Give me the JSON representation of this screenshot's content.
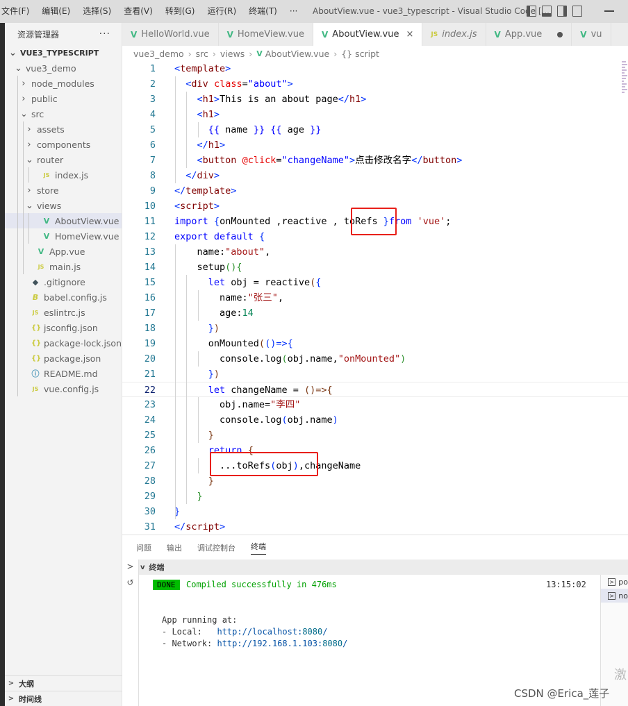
{
  "titlebar": {
    "menu": [
      "文件(F)",
      "编辑(E)",
      "选择(S)",
      "查看(V)",
      "转到(G)",
      "运行(R)",
      "终端(T)",
      "···"
    ],
    "title": "AboutView.vue - vue3_typescript - Visual Studio Code [..."
  },
  "sidebar": {
    "header": "资源管理器",
    "more": "···",
    "tree": [
      {
        "label": "VUE3_TYPESCRIPT",
        "depth": 0,
        "chev": "v",
        "icon": "",
        "root": true
      },
      {
        "label": "vue3_demo",
        "depth": 1,
        "chev": "v",
        "icon": ""
      },
      {
        "label": "node_modules",
        "depth": 2,
        "chev": ">",
        "icon": ""
      },
      {
        "label": "public",
        "depth": 2,
        "chev": ">",
        "icon": ""
      },
      {
        "label": "src",
        "depth": 2,
        "chev": "v",
        "icon": ""
      },
      {
        "label": "assets",
        "depth": 3,
        "chev": ">",
        "icon": ""
      },
      {
        "label": "components",
        "depth": 3,
        "chev": ">",
        "icon": ""
      },
      {
        "label": "router",
        "depth": 3,
        "chev": "v",
        "icon": ""
      },
      {
        "label": "index.js",
        "depth": 4,
        "chev": "",
        "icon": "js"
      },
      {
        "label": "store",
        "depth": 3,
        "chev": ">",
        "icon": ""
      },
      {
        "label": "views",
        "depth": 3,
        "chev": "v",
        "icon": ""
      },
      {
        "label": "AboutView.vue",
        "depth": 4,
        "chev": "",
        "icon": "vue",
        "active": true
      },
      {
        "label": "HomeView.vue",
        "depth": 4,
        "chev": "",
        "icon": "vue"
      },
      {
        "label": "App.vue",
        "depth": 3,
        "chev": "",
        "icon": "vue"
      },
      {
        "label": "main.js",
        "depth": 3,
        "chev": "",
        "icon": "js"
      },
      {
        "label": ".gitignore",
        "depth": 2,
        "chev": "",
        "icon": "git"
      },
      {
        "label": "babel.config.js",
        "depth": 2,
        "chev": "",
        "icon": "babel"
      },
      {
        "label": "eslintrc.js",
        "depth": 2,
        "chev": "",
        "icon": "js"
      },
      {
        "label": "jsconfig.json",
        "depth": 2,
        "chev": "",
        "icon": "json"
      },
      {
        "label": "package-lock.json",
        "depth": 2,
        "chev": "",
        "icon": "json"
      },
      {
        "label": "package.json",
        "depth": 2,
        "chev": "",
        "icon": "json"
      },
      {
        "label": "README.md",
        "depth": 2,
        "chev": "",
        "icon": "info"
      },
      {
        "label": "vue.config.js",
        "depth": 2,
        "chev": "",
        "icon": "js"
      }
    ],
    "outline": "大纲",
    "timeline": "时间线"
  },
  "tabs": [
    {
      "label": "HelloWorld.vue",
      "icon": "vue"
    },
    {
      "label": "HomeView.vue",
      "icon": "vue"
    },
    {
      "label": "AboutView.vue",
      "icon": "vue",
      "active": true,
      "close": "×"
    },
    {
      "label": "index.js",
      "icon": "js"
    },
    {
      "label": "App.vue",
      "icon": "vue",
      "dirty": true
    },
    {
      "label": "vu",
      "icon": "vue"
    }
  ],
  "breadcrumb": [
    "vue3_demo",
    "src",
    "views",
    "AboutView.vue",
    "{} script"
  ],
  "editor": {
    "current_line": 22,
    "lines": [
      [
        [
          "t-br",
          "<"
        ],
        [
          "t-tag",
          "template"
        ],
        [
          "t-br",
          ">"
        ]
      ],
      [
        [
          "",
          "  "
        ],
        [
          "t-br",
          "<"
        ],
        [
          "t-tag",
          "div"
        ],
        [
          "",
          " "
        ],
        [
          "t-attr",
          "class"
        ],
        [
          "",
          "="
        ],
        [
          "t-kw",
          "\"about\""
        ],
        [
          "t-br",
          ">"
        ]
      ],
      [
        [
          "",
          "    "
        ],
        [
          "t-br",
          "<"
        ],
        [
          "t-tag",
          "h1"
        ],
        [
          "t-br",
          ">"
        ],
        [
          "",
          "This is an about page"
        ],
        [
          "t-br",
          "</"
        ],
        [
          "t-tag",
          "h1"
        ],
        [
          "t-br",
          ">"
        ]
      ],
      [
        [
          "",
          "    "
        ],
        [
          "t-br",
          "<"
        ],
        [
          "t-tag",
          "h1"
        ],
        [
          "t-br",
          ">"
        ]
      ],
      [
        [
          "",
          "      "
        ],
        [
          "t-kw",
          "{{"
        ],
        [
          "",
          " name "
        ],
        [
          "t-kw",
          "}}"
        ],
        [
          "",
          " "
        ],
        [
          "t-kw",
          "{{"
        ],
        [
          "",
          " age "
        ],
        [
          "t-kw",
          "}}"
        ]
      ],
      [
        [
          "",
          "    "
        ],
        [
          "t-br",
          "</"
        ],
        [
          "t-tag",
          "h1"
        ],
        [
          "t-br",
          ">"
        ]
      ],
      [
        [
          "",
          "    "
        ],
        [
          "t-br",
          "<"
        ],
        [
          "t-tag",
          "button"
        ],
        [
          "",
          " "
        ],
        [
          "t-attr",
          "@click"
        ],
        [
          "",
          "="
        ],
        [
          "t-kw",
          "\"changeName\""
        ],
        [
          "t-br",
          ">"
        ],
        [
          "",
          "点击修改名字"
        ],
        [
          "t-br",
          "</"
        ],
        [
          "t-tag",
          "button"
        ],
        [
          "t-br",
          ">"
        ]
      ],
      [
        [
          "",
          "  "
        ],
        [
          "t-br",
          "</"
        ],
        [
          "t-tag",
          "div"
        ],
        [
          "t-br",
          ">"
        ]
      ],
      [
        [
          "t-br",
          "</"
        ],
        [
          "t-tag",
          "template"
        ],
        [
          "t-br",
          ">"
        ]
      ],
      [
        [
          "t-br",
          "<"
        ],
        [
          "t-tag",
          "script"
        ],
        [
          "t-br",
          ">"
        ]
      ],
      [
        [
          "t-kw",
          "import"
        ],
        [
          "",
          " "
        ],
        [
          "t-br",
          "{"
        ],
        [
          "",
          "onMounted ,reactive , toRefs "
        ],
        [
          "t-br",
          "}"
        ],
        [
          "t-kw",
          "from"
        ],
        [
          "",
          " "
        ],
        [
          "t-str",
          "'vue'"
        ],
        [
          "",
          ";"
        ]
      ],
      [
        [
          "t-kw",
          "export default"
        ],
        [
          "",
          " "
        ],
        [
          "t-br",
          "{"
        ]
      ],
      [
        [
          "",
          "    name:"
        ],
        [
          "t-str",
          "\"about\""
        ],
        [
          "",
          ","
        ]
      ],
      [
        [
          "",
          "    setup"
        ],
        [
          "t-br2",
          "()"
        ],
        [
          "t-br2",
          "{"
        ]
      ],
      [
        [
          "",
          "      "
        ],
        [
          "t-kw",
          "let"
        ],
        [
          "",
          " obj = reactive"
        ],
        [
          "t-br3",
          "("
        ],
        [
          "t-br",
          "{"
        ]
      ],
      [
        [
          "",
          "        name:"
        ],
        [
          "t-str",
          "\"张三\""
        ],
        [
          "",
          ","
        ]
      ],
      [
        [
          "",
          "        age:"
        ],
        [
          "t-num",
          "14"
        ]
      ],
      [
        [
          "",
          "      "
        ],
        [
          "t-br",
          "}"
        ],
        [
          "t-br3",
          ")"
        ]
      ],
      [
        [
          "",
          "      onMounted"
        ],
        [
          "t-br3",
          "("
        ],
        [
          "t-br",
          "()=>{"
        ]
      ],
      [
        [
          "",
          "        console.log"
        ],
        [
          "t-br2",
          "("
        ],
        [
          "",
          "obj.name,"
        ],
        [
          "t-str",
          "\"onMounted\""
        ],
        [
          "t-br2",
          ")"
        ]
      ],
      [
        [
          "",
          "      "
        ],
        [
          "t-br",
          "}"
        ],
        [
          "t-br3",
          ")"
        ]
      ],
      [
        [
          "",
          "      "
        ],
        [
          "t-kw",
          "let"
        ],
        [
          "",
          " changeName = "
        ],
        [
          "t-br3",
          "()=>{"
        ]
      ],
      [
        [
          "",
          "        obj.name="
        ],
        [
          "t-str",
          "\"李四\""
        ]
      ],
      [
        [
          "",
          "        console.log"
        ],
        [
          "t-br",
          "("
        ],
        [
          "",
          "obj.name"
        ],
        [
          "t-br",
          ")"
        ]
      ],
      [
        [
          "",
          "      "
        ],
        [
          "t-br3",
          "}"
        ]
      ],
      [
        [
          "",
          "      "
        ],
        [
          "t-kw",
          "return"
        ],
        [
          "",
          " "
        ],
        [
          "t-br3",
          "{"
        ]
      ],
      [
        [
          "",
          "        ...toRefs"
        ],
        [
          "t-br",
          "("
        ],
        [
          "",
          "obj"
        ],
        [
          "t-br",
          ")"
        ],
        [
          "",
          ",changeName"
        ]
      ],
      [
        [
          "",
          "      "
        ],
        [
          "t-br3",
          "}"
        ]
      ],
      [
        [
          "",
          "    "
        ],
        [
          "t-br2",
          "}"
        ]
      ],
      [
        [
          "t-br",
          "}"
        ]
      ],
      [
        [
          "t-br",
          "</"
        ],
        [
          "t-tag",
          "script"
        ],
        [
          "t-br",
          ">"
        ]
      ]
    ]
  },
  "panel": {
    "tabs": [
      "问题",
      "输出",
      "调试控制台",
      "终端"
    ],
    "active_tab": "终端",
    "terminal_header": "终端",
    "done": "DONE",
    "compiled": "Compiled successfully in 476ms",
    "time": "13:15:02",
    "running": "App running at:",
    "local_label": "- Local:   ",
    "local_url": "http://localhost:",
    "local_port": "8080",
    "local_tail": "/",
    "network_label": "- Network: ",
    "network_url": "http://192.168.1.103:",
    "network_port": "8080",
    "network_tail": "/",
    "terminals": [
      "po",
      "no"
    ]
  },
  "watermark": "CSDN @Erica_莲子",
  "watermark2": "激"
}
